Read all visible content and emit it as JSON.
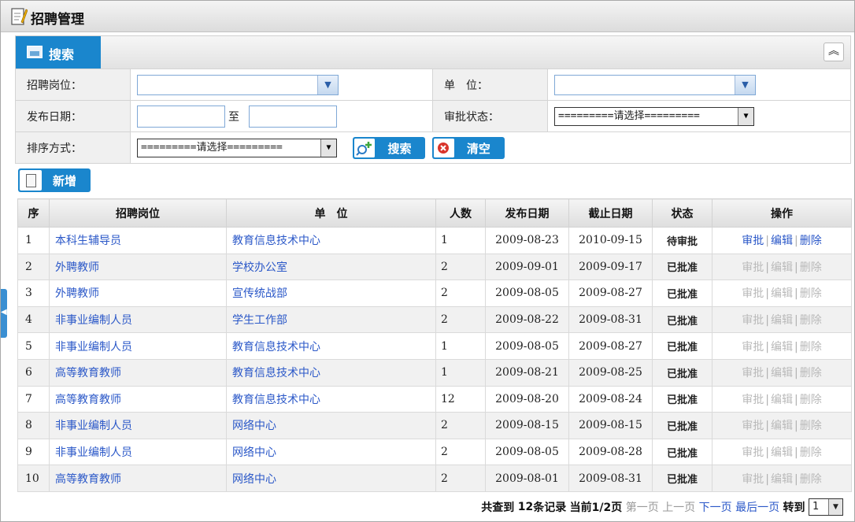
{
  "window": {
    "title": "招聘管理"
  },
  "search": {
    "tab_label": "搜索",
    "collapse_glyph": "⌃",
    "labels": {
      "position": "招聘岗位：",
      "unit": "单　位：",
      "publish_date": "发布日期：",
      "approval_status": "审批状态：",
      "sort": "排序方式："
    },
    "position_value": "",
    "unit_value": "",
    "date_from": "",
    "date_to": "",
    "date_sep": "至",
    "approval_status_value": "=========请选择=========",
    "sort_value": "=========请选择=========",
    "search_button": "搜索",
    "clear_button": "清空"
  },
  "toolbar": {
    "add_button": "新增"
  },
  "table": {
    "headers": [
      "序",
      "招聘岗位",
      "单　位",
      "人数",
      "发布日期",
      "截止日期",
      "状态",
      "操作"
    ],
    "ops": {
      "approve": "审批",
      "edit": "编辑",
      "delete": "删除",
      "sep": "|"
    },
    "rows": [
      {
        "no": "1",
        "position": "本科生辅导员",
        "unit": "教育信息技术中心",
        "count": "1",
        "publish": "2009-08-23",
        "deadline": "2010-09-15",
        "status": "待审批",
        "ops_enabled": true
      },
      {
        "no": "2",
        "position": "外聘教师",
        "unit": "学校办公室",
        "count": "2",
        "publish": "2009-09-01",
        "deadline": "2009-09-17",
        "status": "已批准",
        "ops_enabled": false
      },
      {
        "no": "3",
        "position": "外聘教师",
        "unit": "宣传统战部",
        "count": "2",
        "publish": "2009-08-05",
        "deadline": "2009-08-27",
        "status": "已批准",
        "ops_enabled": false
      },
      {
        "no": "4",
        "position": "非事业编制人员",
        "unit": "学生工作部",
        "count": "2",
        "publish": "2009-08-22",
        "deadline": "2009-08-31",
        "status": "已批准",
        "ops_enabled": false
      },
      {
        "no": "5",
        "position": "非事业编制人员",
        "unit": "教育信息技术中心",
        "count": "1",
        "publish": "2009-08-05",
        "deadline": "2009-08-27",
        "status": "已批准",
        "ops_enabled": false
      },
      {
        "no": "6",
        "position": "高等教育教师",
        "unit": "教育信息技术中心",
        "count": "1",
        "publish": "2009-08-21",
        "deadline": "2009-08-25",
        "status": "已批准",
        "ops_enabled": false
      },
      {
        "no": "7",
        "position": "高等教育教师",
        "unit": "教育信息技术中心",
        "count": "12",
        "publish": "2009-08-20",
        "deadline": "2009-08-24",
        "status": "已批准",
        "ops_enabled": false
      },
      {
        "no": "8",
        "position": "非事业编制人员",
        "unit": "网络中心",
        "count": "2",
        "publish": "2009-08-15",
        "deadline": "2009-08-15",
        "status": "已批准",
        "ops_enabled": false
      },
      {
        "no": "9",
        "position": "非事业编制人员",
        "unit": "网络中心",
        "count": "2",
        "publish": "2009-08-05",
        "deadline": "2009-08-28",
        "status": "已批准",
        "ops_enabled": false
      },
      {
        "no": "10",
        "position": "高等教育教师",
        "unit": "网络中心",
        "count": "2",
        "publish": "2009-08-01",
        "deadline": "2009-08-31",
        "status": "已批准",
        "ops_enabled": false
      }
    ]
  },
  "pager": {
    "summary_prefix": "共查到",
    "total": "12",
    "summary_suffix": "条记录",
    "current_label": "当前1/2页",
    "first": "第一页",
    "prev": "上一页",
    "next": "下一页",
    "last": "最后一页",
    "goto_label": "转到",
    "page_value": "1"
  },
  "colors": {
    "accent": "#1a86cd",
    "link": "#2b58c8",
    "disabled": "#b9b9b9"
  }
}
